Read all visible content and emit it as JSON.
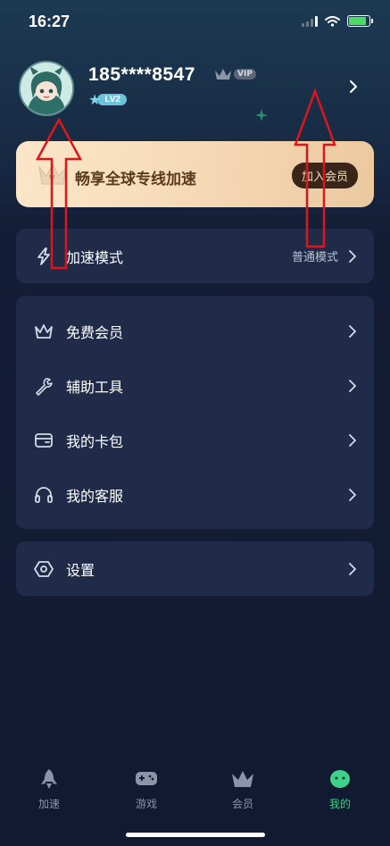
{
  "status_bar": {
    "time": "16:27"
  },
  "profile": {
    "phone": "185****8547",
    "vip_label": "VIP",
    "level": "LV2"
  },
  "promo": {
    "text": "畅享全球专线加速",
    "button": "加入会员"
  },
  "menu_mode": {
    "label": "加速模式",
    "value": "普通模式"
  },
  "menu_group": [
    {
      "label": "免费会员",
      "icon": "crown-icon"
    },
    {
      "label": "辅助工具",
      "icon": "wrench-icon"
    },
    {
      "label": "我的卡包",
      "icon": "wallet-icon"
    },
    {
      "label": "我的客服",
      "icon": "headset-icon"
    }
  ],
  "settings": {
    "label": "设置",
    "icon": "settings-icon"
  },
  "tabs": [
    {
      "label": "加速",
      "icon": "rocket-icon",
      "active": false
    },
    {
      "label": "游戏",
      "icon": "gamepad-icon",
      "active": false
    },
    {
      "label": "会员",
      "icon": "crown-icon",
      "active": false
    },
    {
      "label": "我的",
      "icon": "mascot-icon",
      "active": true
    }
  ],
  "colors": {
    "accent_green": "#3fd08a",
    "card_bg": "#1f2b49",
    "promo_bg": "#f6dbb8",
    "annotation_red": "#e0151b"
  }
}
